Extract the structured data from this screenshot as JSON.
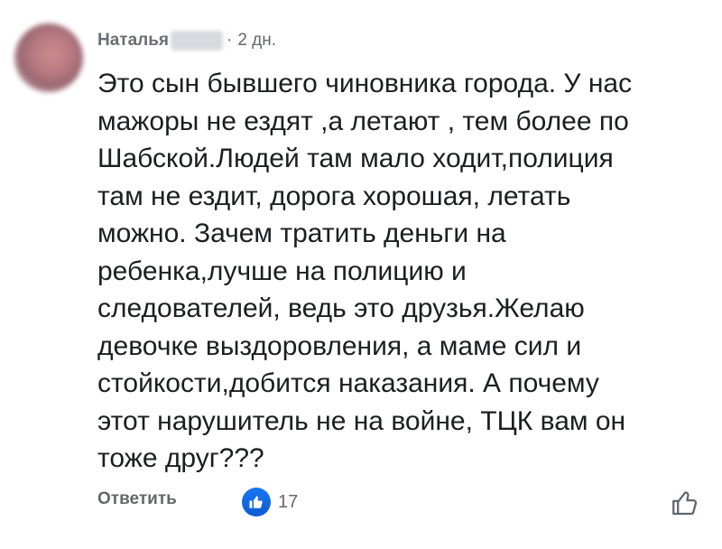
{
  "comment": {
    "author": "Наталья",
    "separator": "·",
    "time": "2 дн.",
    "text_lines": [
      "Это сын бывшего чиновника города. У нас",
      "мажоры не ездят ,а летают , тем более по",
      "Шабской.Людей там мало ходит,полиция",
      "там не ездит, дорога хорошая, летать",
      "можно. Зачем тратить деньги на",
      "ребенка,лучше на полицию и",
      "следователей, ведь это друзья.Желаю",
      "девочке выздоровления, а маме  сил и",
      "стойкости,добится наказания. А почему",
      "этот нарушитель не на войне, ТЦК   вам он",
      "тоже друг???"
    ],
    "actions": {
      "reply_label": "Ответить",
      "like_count": "17",
      "reaction_icon": "thumbs-up-icon",
      "like_button_icon": "thumbs-up-outline-icon"
    },
    "colors": {
      "like_badge": "#1877f2",
      "text": "#1c1e21",
      "meta": "#65676b"
    }
  }
}
